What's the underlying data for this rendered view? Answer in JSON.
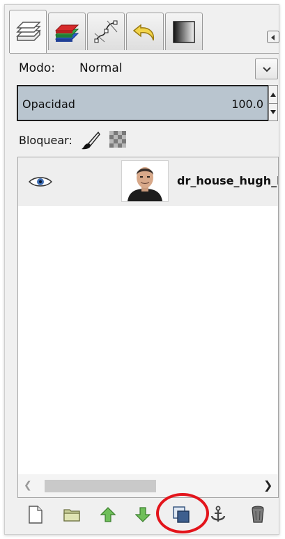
{
  "tabs": [
    {
      "name": "layers",
      "icon": "layers-icon",
      "active": true
    },
    {
      "name": "channels",
      "icon": "channels-icon"
    },
    {
      "name": "paths",
      "icon": "paths-icon"
    },
    {
      "name": "undo-history",
      "icon": "undo-icon"
    },
    {
      "name": "gradient",
      "icon": "gradient-icon"
    }
  ],
  "mode": {
    "label": "Modo:",
    "value": "Normal"
  },
  "opacity": {
    "label": "Opacidad",
    "value": "100.0",
    "fill_percent": 100
  },
  "lock": {
    "label": "Bloquear:",
    "icons": [
      "brush-lock-icon",
      "alpha-lock-icon"
    ]
  },
  "layers": [
    {
      "visible": true,
      "thumbnail": "portrait-thumbnail",
      "name": "dr_house_hugh_l"
    }
  ],
  "bottom_toolbar": [
    "new-layer-icon",
    "open-folder-icon",
    "raise-layer-icon",
    "lower-layer-icon",
    "duplicate-layer-icon",
    "anchor-icon",
    "delete-layer-icon"
  ],
  "annotation": {
    "highlighted": "duplicate-layer-icon",
    "color": "#e3141b"
  },
  "colors": {
    "opacity_bar": "#b9c5cf",
    "selected_row": "#eeeeee",
    "panel_bg": "#f0f0f0"
  }
}
